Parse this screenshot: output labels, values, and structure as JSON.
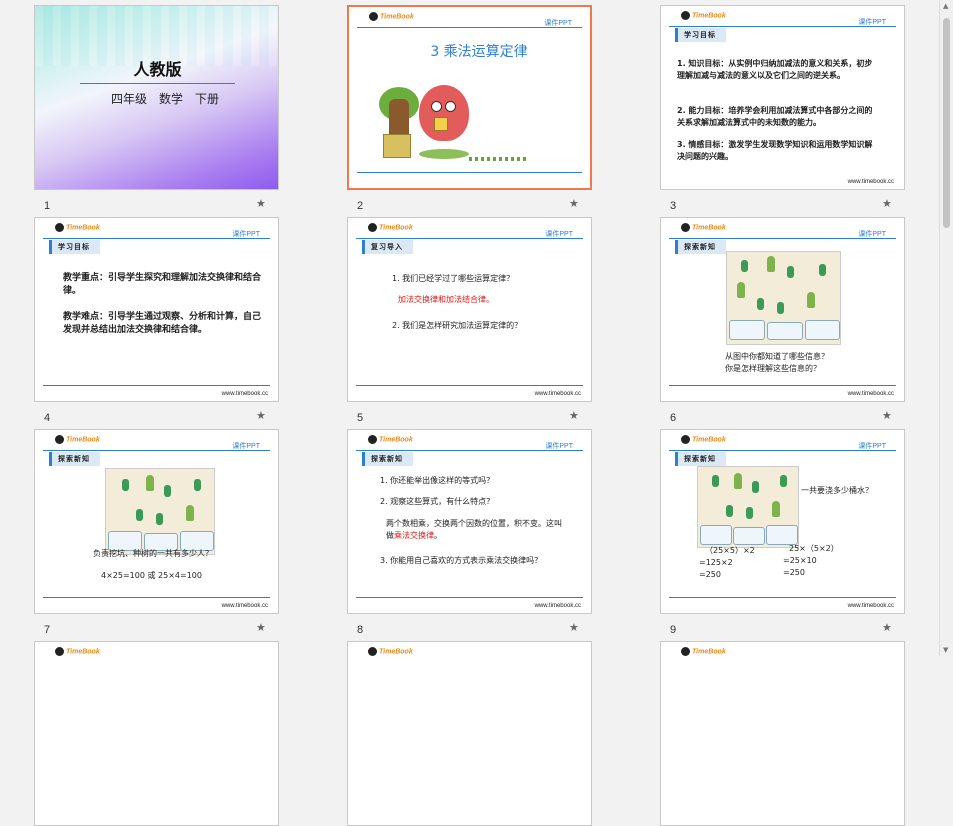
{
  "slides": [
    {
      "num": "1",
      "title": "人教版",
      "subtitle": "四年级　数学　下册"
    },
    {
      "num": "2",
      "logo": "TimeBook",
      "tag": "课件PPT",
      "title": "3  乘法运算定律"
    },
    {
      "num": "3",
      "logo": "TimeBook",
      "tag": "课件PPT",
      "section": "学习目标",
      "footer": "www.timebook.cc",
      "p1": "1. 知识目标：从实例中归纳加减法的意义和关系，初步理解加减与减法的意义以及它们之间的逆关系。",
      "p2": "2. 能力目标：培养学会利用加减法算式中各部分之间的关系求解加减法算式中的未知数的能力。",
      "p3": "3. 情感目标：激发学生发现数学知识和运用数学知识解决问题的兴趣。"
    },
    {
      "num": "4",
      "logo": "TimeBook",
      "tag": "课件PPT",
      "section": "学习目标",
      "footer": "www.timebook.cc",
      "p1": "教学重点：引导学生探究和理解加法交换律和结合律。",
      "p2": "教学难点：引导学生通过观察、分析和计算，自己发现并总结出加法交换律和结合律。"
    },
    {
      "num": "5",
      "logo": "TimeBook",
      "tag": "课件PPT",
      "section": "复习导入",
      "footer": "www.timebook.cc",
      "q1": "1.  我们已经学过了哪些运算定律？",
      "a1": "加法交换律和加法结合律。",
      "q2": "2.  我们是怎样研究加法运算定律的？"
    },
    {
      "num": "6",
      "logo": "TimeBook",
      "tag": "课件PPT",
      "section": "探索新知",
      "footer": "www.timebook.cc",
      "l1": "从图中你都知道了哪些信息？",
      "l2": "你是怎样理解这些信息的？"
    },
    {
      "num": "7",
      "logo": "TimeBook",
      "tag": "课件PPT",
      "section": "探索新知",
      "footer": "www.timebook.cc",
      "l1": "负责挖坑、种树的一共有多少人？",
      "l2": "4×25=100  或  25×4=100"
    },
    {
      "num": "8",
      "logo": "TimeBook",
      "tag": "课件PPT",
      "section": "探索新知",
      "footer": "www.timebook.cc",
      "q1": "1.  你还能举出像这样的等式吗？",
      "q2": "2.  观察这些算式，有什么特点？",
      "a1": "两个数相乘，交换两个因数的位置，积不变。这叫做",
      "a1red": "乘法交换律",
      "a1end": "。",
      "q3": "3.  你能用自己喜欢的方式表示乘法交换律吗？"
    },
    {
      "num": "9",
      "logo": "TimeBook",
      "tag": "课件PPT",
      "section": "探索新知",
      "footer": "www.timebook.cc",
      "q": "一共要浇多少桶水？",
      "left": [
        "（25×5）×2",
        "=125×2",
        "=250"
      ],
      "right": [
        "25×（5×2）",
        "=25×10",
        "=250"
      ]
    },
    {
      "logo": "TimeBook"
    },
    {
      "logo": "TimeBook"
    },
    {
      "logo": "TimeBook"
    }
  ],
  "star": "★"
}
